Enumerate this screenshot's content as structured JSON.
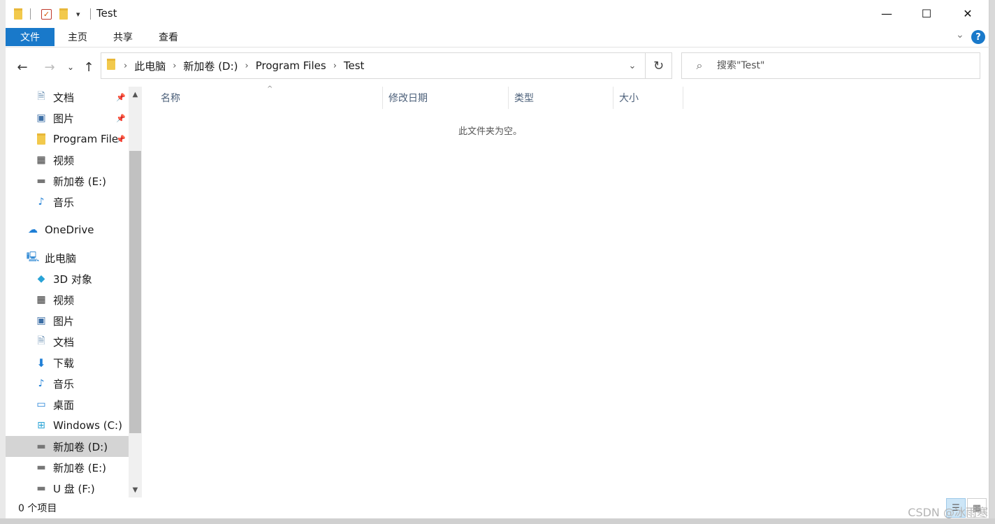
{
  "window": {
    "title": "Test",
    "controls": {
      "minimize": "—",
      "maximize": "☐",
      "close": "✕"
    }
  },
  "quick_access_toolbar": {
    "dropdown": "▾"
  },
  "ribbon": {
    "tabs": [
      "文件",
      "主页",
      "共享",
      "查看"
    ],
    "collapse": "⌄",
    "help": "?"
  },
  "navigation": {
    "back": "←",
    "forward": "→",
    "recent": "⌄",
    "up": "↑",
    "breadcrumbs": [
      "此电脑",
      "新加卷 (D:)",
      "Program Files",
      "Test"
    ],
    "dropdown": "⌄",
    "refresh": "↻"
  },
  "search": {
    "placeholder": "搜索\"Test\"",
    "icon": "search-icon"
  },
  "sidebar": {
    "items": [
      {
        "label": "文档",
        "icon": "document-icon",
        "pinned": true
      },
      {
        "label": "图片",
        "icon": "picture-icon",
        "pinned": true
      },
      {
        "label": "Program File",
        "icon": "folder-icon",
        "pinned": true
      },
      {
        "label": "视频",
        "icon": "video-icon"
      },
      {
        "label": "新加卷 (E:)",
        "icon": "drive-icon"
      },
      {
        "label": "音乐",
        "icon": "music-icon"
      },
      {
        "label": "OneDrive",
        "icon": "cloud-icon"
      },
      {
        "label": "此电脑",
        "icon": "computer-icon"
      },
      {
        "label": "3D 对象",
        "icon": "cube-icon"
      },
      {
        "label": "视频",
        "icon": "video-icon"
      },
      {
        "label": "图片",
        "icon": "picture-icon"
      },
      {
        "label": "文档",
        "icon": "document-icon"
      },
      {
        "label": "下载",
        "icon": "download-icon"
      },
      {
        "label": "音乐",
        "icon": "music-icon"
      },
      {
        "label": "桌面",
        "icon": "desktop-icon"
      },
      {
        "label": "Windows (C:)",
        "icon": "windows-drive-icon"
      },
      {
        "label": "新加卷 (D:)",
        "icon": "drive-icon",
        "selected": true
      },
      {
        "label": "新加卷 (E:)",
        "icon": "drive-icon"
      },
      {
        "label": "U 盘 (F:)",
        "icon": "drive-icon"
      }
    ]
  },
  "columns": [
    "名称",
    "修改日期",
    "类型",
    "大小"
  ],
  "empty_message": "此文件夹为空。",
  "status": {
    "item_count": "0 个项目"
  },
  "watermark": "CSDN @冰雨寒"
}
